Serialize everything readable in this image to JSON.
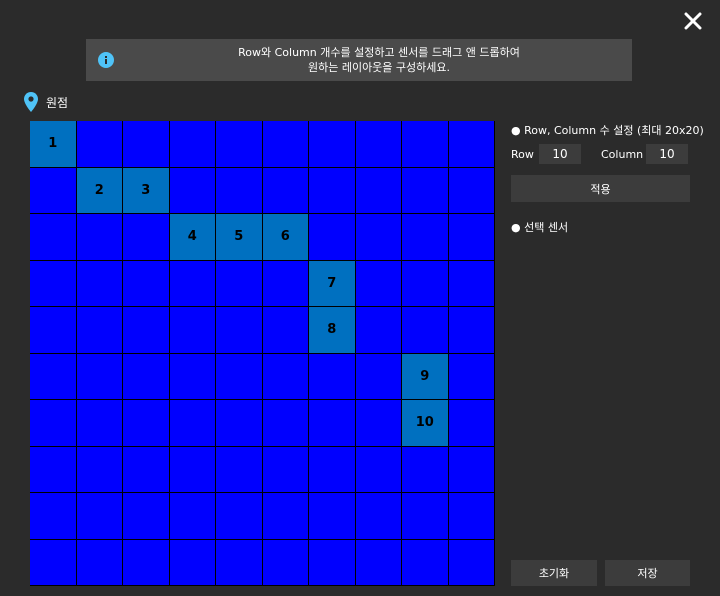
{
  "dialog": {
    "info_line1": "Row와 Column 개수를 설정하고 센서를 드래그 앤 드롭하여",
    "info_line2": "원하는 레이아웃을 구성하세요.",
    "origin_label": "원점"
  },
  "grid": {
    "rows": 10,
    "columns": 10,
    "cell_color": "#0000ff",
    "selected_color": "#0070c0",
    "sensors": [
      {
        "label": "1",
        "row": 1,
        "col": 1
      },
      {
        "label": "2",
        "row": 2,
        "col": 2
      },
      {
        "label": "3",
        "row": 2,
        "col": 3
      },
      {
        "label": "4",
        "row": 3,
        "col": 4
      },
      {
        "label": "5",
        "row": 3,
        "col": 5
      },
      {
        "label": "6",
        "row": 3,
        "col": 6
      },
      {
        "label": "7",
        "row": 4,
        "col": 7
      },
      {
        "label": "8",
        "row": 5,
        "col": 7
      },
      {
        "label": "9",
        "row": 6,
        "col": 9
      },
      {
        "label": "10",
        "row": 7,
        "col": 9
      }
    ]
  },
  "settings": {
    "title": "● Row, Column 수 설정 (최대 20x20)",
    "row_label": "Row",
    "row_value": "10",
    "column_label": "Column",
    "column_value": "10",
    "apply_label": "적용",
    "selected_title": "● 선택 센서"
  },
  "footer": {
    "reset_label": "초기화",
    "save_label": "저장"
  },
  "colors": {
    "accent": "#4fc3f7",
    "background": "#2b2b2b"
  }
}
